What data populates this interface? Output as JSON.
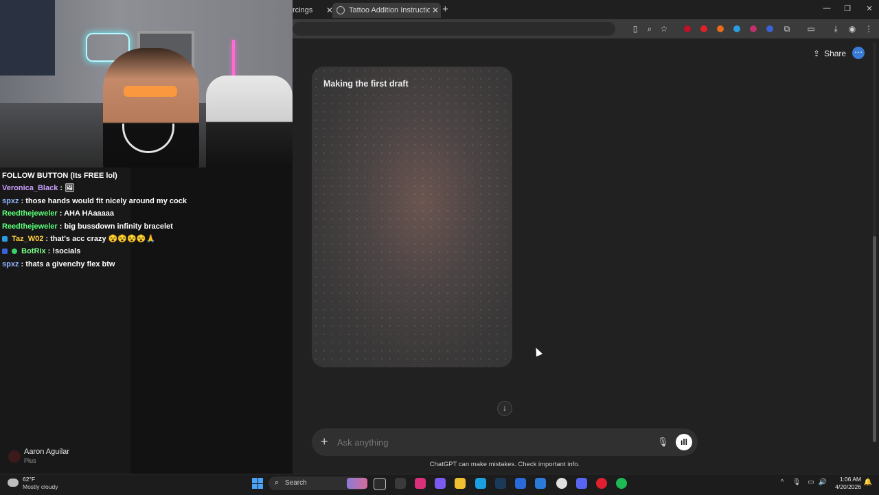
{
  "browser": {
    "tabs": [
      {
        "label": "rcings",
        "active": false
      },
      {
        "label": "Tattoo Addition Instructions",
        "active": true
      }
    ],
    "close_glyph": "✕",
    "new_tab_glyph": "+",
    "window_controls": {
      "minimize": "—",
      "maximize": "❐",
      "close": "✕"
    },
    "toolbar_icons": [
      "page-icon",
      "zoom-icon",
      "star-icon",
      "extension-icons",
      "puzzle-icon",
      "cast-icon",
      "download-icon",
      "profile-icon",
      "menu-icon"
    ]
  },
  "chatgpt": {
    "share_label": "Share",
    "share_glyph": "⇪",
    "more_glyph": "⋯",
    "card_title": "Making the first draft",
    "scroll_down_glyph": "↓",
    "composer_plus": "+",
    "composer_placeholder": "Ask anything",
    "mic_glyph": "🎙",
    "voice_glyph": "ıll",
    "disclaimer": "ChatGPT can make mistakes. Check important info."
  },
  "stream_chat": {
    "header": "FOLLOW BUTTON (Its FREE lol)",
    "messages": [
      {
        "user": "Veronica_Black",
        "text": ": 🖼",
        "color": "#c9a0ff"
      },
      {
        "user": "spxz",
        "text": ": those hands would fit nicely around my cock",
        "color": "#8fb4ff"
      },
      {
        "user": "Reedthejeweler",
        "text": ": AHA HAaaaaa",
        "color": "#5cff7a"
      },
      {
        "user": "Reedthejeweler",
        "text": ": big bussdown infinity bracelet",
        "color": "#5cff7a"
      },
      {
        "user": "Taz_W02",
        "text": ": that's acc crazy 😵😵😵😵🙏",
        "color": "#ffd23f"
      },
      {
        "user": "BotRix",
        "text": ": !socials",
        "color": "#7aff8a"
      },
      {
        "user": "spxz",
        "text": ": thats a givenchy flex btw",
        "color": "#8fb4ff"
      }
    ]
  },
  "profile": {
    "name": "Aaron Aguilar",
    "plan": "Plus"
  },
  "taskbar": {
    "weather_temp": "62°F",
    "weather_desc": "Mostly cloudy",
    "search_label": "Search",
    "search_glyph": "⌕",
    "time": "1:06 AM",
    "date": "4/20/2026",
    "tray": {
      "chevron": "^",
      "mic": "🎙",
      "network": "▭",
      "volume": "🔊",
      "bell": "🔔"
    }
  },
  "colors": {
    "accent_more": "#3a7bd5",
    "background": "#212121"
  }
}
